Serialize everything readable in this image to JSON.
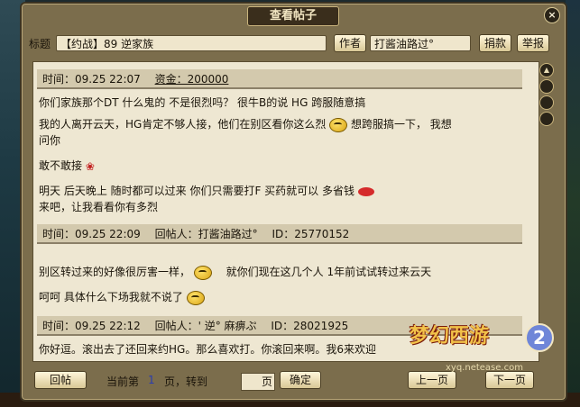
{
  "window": {
    "title": "查看帖子",
    "close_glyph": "×"
  },
  "header": {
    "subject_label": "标题",
    "subject_value": "【约战】89 逆家族",
    "author_button": "作者",
    "author_value": "打酱油路过°",
    "donate_button": "捐款",
    "report_button": "举报"
  },
  "posts": [
    {
      "time": "时间：09.25 22:07",
      "funds": "资金：200000",
      "lines": [
        "你们家族那个DT 什么鬼的 不是很烈吗？ 很牛B的说  HG 跨服随意搞",
        "我的人离开云天，HG肯定不够人接，他们在别区看你这么烈",
        "想跨服搞一下， 我想",
        "问你",
        "敢不敢接",
        "明天 后天晚上 随时都可以过来 你们只需要打F 买药就可以 多省钱",
        "来吧，让我看看你有多烈"
      ]
    },
    {
      "time": "时间：09.25 22:09",
      "replier": "回帖人：打酱油路过°",
      "id": "ID：25770152",
      "lines": [
        "别区转过来的好像很厉害一样，",
        "就你们现在这几个人 1年前试试转过来云天",
        "呵呵 具体什么下场我就不说了"
      ]
    },
    {
      "time": "时间：09.25 22:12",
      "replier": "回帖人：' 逆° 麻痹ぷ",
      "id": "ID：28021925",
      "lines": [
        "你好逗。滚出去了还回来约HG。那么喜欢打。你滚回来啊。我6来欢迎"
      ]
    }
  ],
  "footer": {
    "reply_button": "回帖",
    "current_label": "当前第",
    "current_page": "1",
    "page_goto_label": "页，转到",
    "page_label": "页",
    "confirm_button": "确定",
    "prev_button": "上一页",
    "next_button": "下一页"
  },
  "logo": {
    "text": "梦幻西游",
    "number": "2",
    "url": "xyq.netease.com"
  },
  "colors": {
    "window_bg": "#7b6d4c",
    "content_bg": "#eee7d2",
    "header_bar": "#d3c9ad"
  }
}
